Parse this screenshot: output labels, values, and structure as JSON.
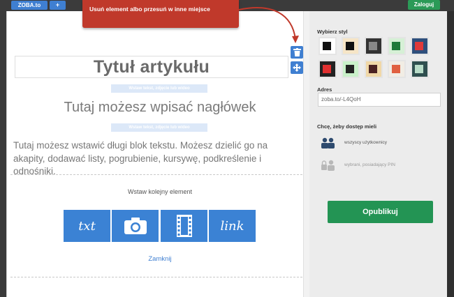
{
  "topbar": {
    "brand_button": "ZOBA.to",
    "add_button": "+",
    "login_button": "Zaloguj"
  },
  "tooltip": {
    "text": "Usuń element albo przesuń w inne miejsce"
  },
  "editor": {
    "title": "Tytuł artykułu",
    "insert_hint_1": "Wstaw tekst, zdjęcie lub wideo",
    "heading": "Tutaj możesz wpisać nagłówek",
    "insert_hint_2": "Wstaw tekst, zdjęcie lub wideo",
    "body_text": "Tutaj możesz wstawić długi blok tekstu. Możesz dzielić go na akapity, dodawać listy, pogrubienie, kursywę, podkreślenie i odnośniki.",
    "insert_label": "Wstaw kolejny element",
    "tiles": {
      "txt": "txt",
      "link": "link"
    },
    "close_link": "Zamknij"
  },
  "sidebar": {
    "style_label": "Wybierz styl",
    "styles": [
      {
        "border": "#e4e4e4",
        "bg": "#ffffff",
        "fg": "#111111"
      },
      {
        "border": "#e4e4e4",
        "bg": "#f6e5c6",
        "fg": "#111111"
      },
      {
        "border": "#e4e4e4",
        "bg": "#333333",
        "fg": "#888888"
      },
      {
        "border": "#e4e4e4",
        "bg": "#d6f0d6",
        "fg": "#1e7a3a"
      },
      {
        "border": "#e4e4e4",
        "bg": "#2e4f7c",
        "fg": "#e03a3a"
      },
      {
        "border": "#e4e4e4",
        "bg": "#222222",
        "fg": "#e03030"
      },
      {
        "border": "#e4e4e4",
        "bg": "#c9f0c9",
        "fg": "#222222"
      },
      {
        "border": "#e4e4e4",
        "bg": "#f0d8a8",
        "fg": "#4a2222"
      },
      {
        "border": "#e4e4e4",
        "bg": "#f1ede4",
        "fg": "#e06040"
      },
      {
        "border": "#e4e4e4",
        "bg": "#2f4f4f",
        "fg": "#b8dcc8"
      }
    ],
    "address_label": "Adres",
    "address_value": "zoba.to/-L4QoH",
    "access_label": "Chcę, żeby dostęp mieli",
    "access_all": "wszyscy użytkownicy",
    "access_pin": "wybrani, posiadający PIN",
    "publish_button": "Opublikuj"
  }
}
